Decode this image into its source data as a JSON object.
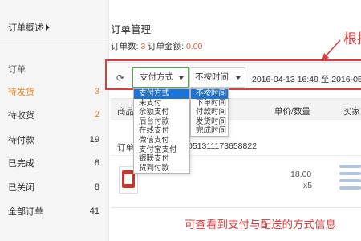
{
  "sidebar": {
    "overview": "订单概述",
    "section": "订单",
    "items": [
      {
        "label": "待发货",
        "count": "3"
      },
      {
        "label": "待收货",
        "count": "2"
      },
      {
        "label": "待付款",
        "count": "19"
      },
      {
        "label": "已完成",
        "count": "8"
      },
      {
        "label": "已关闭",
        "count": "8"
      },
      {
        "label": "全部订单",
        "count": "41"
      }
    ]
  },
  "main": {
    "title": "订单管理",
    "summary": {
      "count_label": "订单数: ",
      "count_value": "3",
      "amount_label": " 订单金额: ",
      "amount_value": "0.00"
    }
  },
  "filter": {
    "refresh_icon": "refresh-icon",
    "payment_select": "支付方式",
    "time_select": "不按时间",
    "date_range": "2016-04-13 16:49 至 2016-05"
  },
  "payment_options": [
    "支付方式",
    "未支付",
    "余额支付",
    "后台付款",
    "在线支付",
    "微信支付",
    "支付宝支付",
    "银联支付",
    "货到付款"
  ],
  "time_options": [
    "不按时间",
    "下单时间",
    "付款时间",
    "发货时间",
    "完成时间"
  ],
  "table": {
    "headers": {
      "product": "商品",
      "price_qty": "单价/数量",
      "buyer": "买家"
    },
    "order_label": "订单",
    "order_number": "051311173658822",
    "price": "18.00",
    "qty": "x5"
  },
  "annotations": {
    "top": "根据",
    "bottom": "可查看到支付与配送的方式信息"
  },
  "colors": {
    "accent": "#e8821e",
    "highlight": "#e8553a",
    "annotation": "#e03b3b",
    "dropdown_selected": "#1e73d8"
  }
}
